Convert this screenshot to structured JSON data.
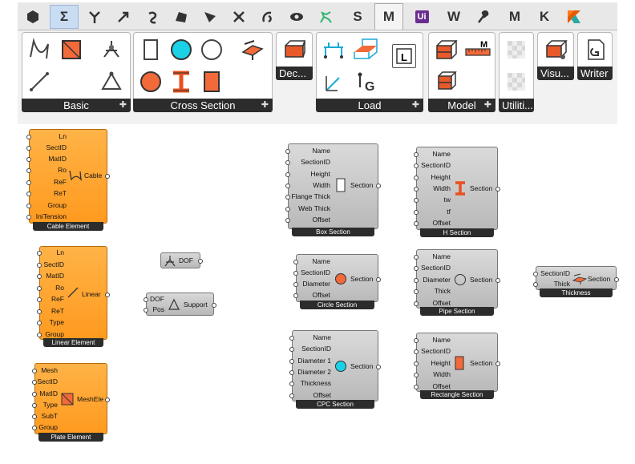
{
  "ribbon": {
    "tabs": [
      {
        "id": "params",
        "text": ""
      },
      {
        "id": "maths",
        "text": "Σ"
      },
      {
        "id": "sets",
        "text": ""
      },
      {
        "id": "vector",
        "text": ""
      },
      {
        "id": "curve",
        "text": ""
      },
      {
        "id": "surface",
        "text": ""
      },
      {
        "id": "mesh",
        "text": ""
      },
      {
        "id": "intersect",
        "text": ""
      },
      {
        "id": "transform",
        "text": ""
      },
      {
        "id": "display",
        "text": ""
      },
      {
        "id": "kangaroo",
        "text": ""
      },
      {
        "id": "s-tab",
        "text": "S"
      },
      {
        "id": "m-tab",
        "text": "M"
      },
      {
        "id": "ui-tab",
        "text": "Ui"
      },
      {
        "id": "w-tab",
        "text": "W"
      },
      {
        "id": "tool-tab",
        "text": ""
      },
      {
        "id": "m2-tab",
        "text": "M"
      },
      {
        "id": "k-tab",
        "text": "K"
      },
      {
        "id": "k2-tab",
        "text": ""
      }
    ],
    "panels": {
      "basic": "Basic",
      "cross_section": "Cross Section",
      "dec": "Dec...",
      "load": "Load",
      "model": "Model",
      "utilities": "Utiliti...",
      "visu": "Visu...",
      "writer": "Writer"
    }
  },
  "components": {
    "cable": {
      "title": "Cable Element",
      "center": "Cable",
      "inputs": [
        "Ln",
        "SectID",
        "MatID",
        "Ro",
        "ReF",
        "ReT",
        "Group",
        "IniTension"
      ]
    },
    "linear": {
      "title": "Linear Element",
      "center": "Linear",
      "inputs": [
        "Ln",
        "SectID",
        "MatID",
        "Ro",
        "ReF",
        "ReT",
        "Type",
        "Group"
      ]
    },
    "plate": {
      "title": "Plate Element",
      "center": "MeshEle",
      "inputs": [
        "Mesh",
        "SectID",
        "MatID",
        "Type",
        "SubT",
        "Group"
      ]
    },
    "dof": {
      "label": "DOF"
    },
    "support": {
      "output": "Support",
      "inputs": [
        "DOF",
        "Pos"
      ]
    },
    "box": {
      "title": "Box Section",
      "output": "Section",
      "inputs": [
        "Name",
        "SectionID",
        "Height",
        "Width",
        "Flange Thick",
        "Web Thick",
        "Offset"
      ]
    },
    "hsec": {
      "title": "H Section",
      "output": "Section",
      "inputs": [
        "Name",
        "SectionID",
        "Height",
        "Width",
        "tw",
        "tf",
        "Offset"
      ]
    },
    "circle": {
      "title": "Circle Section",
      "output": "Section",
      "inputs": [
        "Name",
        "SectionID",
        "Diameter",
        "Offset"
      ]
    },
    "pipe": {
      "title": "Pipe Section",
      "output": "Section",
      "inputs": [
        "Name",
        "SectionID",
        "Diameter",
        "Thick",
        "Offset"
      ]
    },
    "cpc": {
      "title": "CPC Section",
      "output": "Section",
      "inputs": [
        "Name",
        "SectionID",
        "Diameter 1",
        "Diameter 2",
        "Thickness",
        "Offset"
      ]
    },
    "rect": {
      "title": "Rectangle Section",
      "output": "Section",
      "inputs": [
        "Name",
        "SectionID",
        "Height",
        "Width",
        "Offset"
      ]
    },
    "thickness": {
      "title": "Thickness",
      "output": "Section",
      "inputs": [
        "SectionID",
        "Thick"
      ]
    }
  }
}
